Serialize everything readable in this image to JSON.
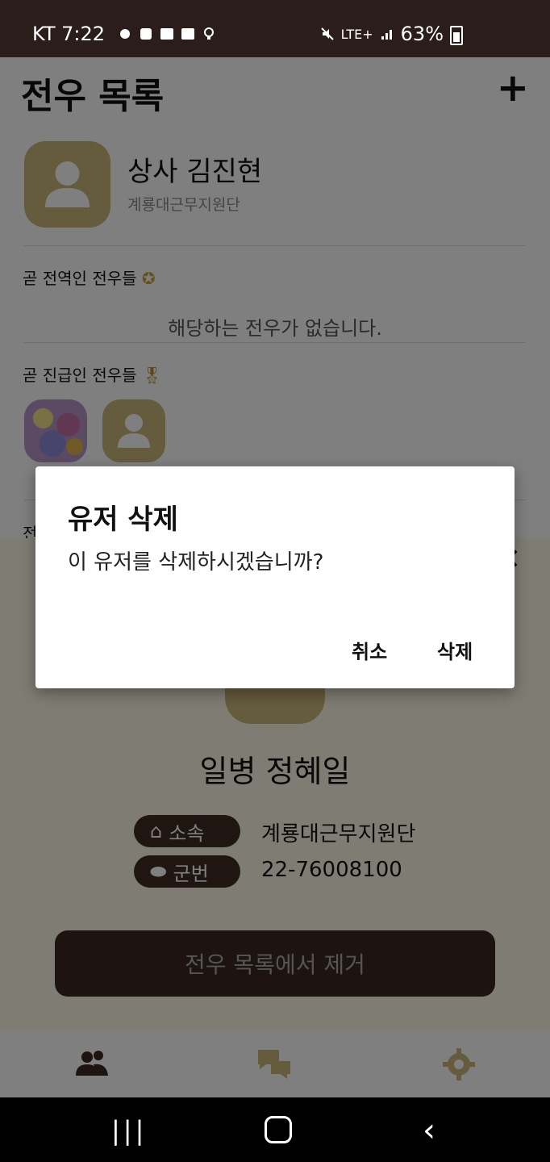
{
  "status_bar": {
    "carrier_time": "KT 7:22",
    "network": "LTE+",
    "battery": "63%"
  },
  "header": {
    "title": "전우 목록",
    "add_label": "+"
  },
  "me": {
    "name": "상사 김진현",
    "unit": "계룡대근무지원단"
  },
  "sections": {
    "discharge_label": "곧 전역인 전우들",
    "discharge_empty": "해당하는 전우가 없습니다.",
    "promotion_label": "곧 진급인 전우들",
    "friends_label": "전"
  },
  "sheet": {
    "name": "일병 정혜일",
    "unit_tag": "소속",
    "unit_value": "계룡대근무지원단",
    "number_tag": "군번",
    "number_value": "22-76008100",
    "remove_button": "전우 목록에서 제거"
  },
  "dialog": {
    "title": "유저 삭제",
    "message": "이 유저를 삭제하시겠습니까?",
    "cancel": "취소",
    "confirm": "삭제"
  },
  "colors": {
    "brand_dark": "#3b2620",
    "avatar_gold": "#cbb77a",
    "sheet_bg": "#fffbe6"
  },
  "icons": {
    "nav": [
      "people-icon",
      "chat-icon",
      "gear-icon"
    ]
  }
}
